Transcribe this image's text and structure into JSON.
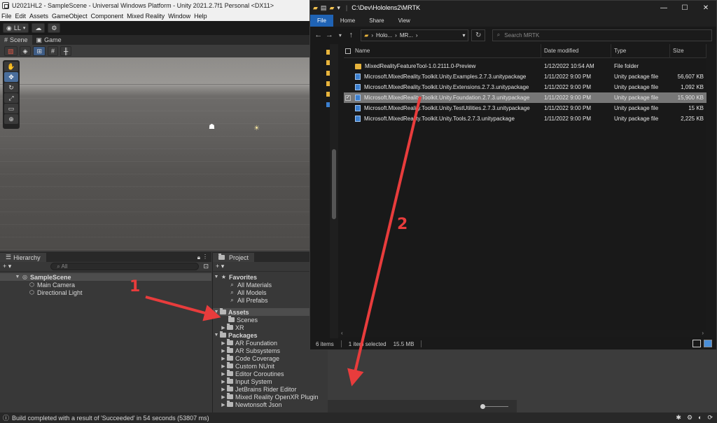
{
  "unity": {
    "window_title": "U2021HL2 - SampleScene - Universal Windows Platform - Unity 2021.2.7f1 Personal <DX11>",
    "menu": [
      "File",
      "Edit",
      "Assets",
      "GameObject",
      "Component",
      "Mixed Reality",
      "Window",
      "Help"
    ],
    "account_label": "LL",
    "tabs": [
      "Scene",
      "Game"
    ],
    "hierarchy": {
      "tab_label": "Hierarchy",
      "search_placeholder": "All",
      "scene_name": "SampleScene",
      "items": [
        "Main Camera",
        "Directional Light"
      ]
    },
    "project": {
      "tab_label": "Project",
      "favorites_label": "Favorites",
      "favorites": [
        "All Materials",
        "All Models",
        "All Prefabs"
      ],
      "assets_label": "Assets",
      "assets": [
        "Scenes",
        "XR"
      ],
      "packages_label": "Packages",
      "packages": [
        "AR Foundation",
        "AR Subsystems",
        "Code Coverage",
        "Custom NUnit",
        "Editor Coroutines",
        "Input System",
        "JetBrains Rider Editor",
        "Mixed Reality OpenXR Plugin",
        "Newtonsoft Json"
      ]
    },
    "status_message": "Build completed with a result of 'Succeeded' in 54 seconds (53807 ms)"
  },
  "explorer": {
    "title_path": "C:\\Dev\\Hololens2\\MRTK",
    "ribbon_tabs": [
      "File",
      "Home",
      "Share",
      "View"
    ],
    "breadcrumb": [
      "Holo...",
      "MR..."
    ],
    "search_placeholder": "Search MRTK",
    "columns": {
      "name": "Name",
      "date": "Date modified",
      "type": "Type",
      "size": "Size"
    },
    "rows": [
      {
        "name": "MixedRealityFeatureTool-1.0.2111.0-Preview",
        "date": "1/12/2022 10:54 AM",
        "type": "File folder",
        "size": "",
        "kind": "folder",
        "selected": false
      },
      {
        "name": "Microsoft.MixedReality.Toolkit.Unity.Examples.2.7.3.unitypackage",
        "date": "1/11/2022 9:00 PM",
        "type": "Unity package file",
        "size": "56,607 KB",
        "kind": "package",
        "selected": false
      },
      {
        "name": "Microsoft.MixedReality.Toolkit.Unity.Extensions.2.7.3.unitypackage",
        "date": "1/11/2022 9:00 PM",
        "type": "Unity package file",
        "size": "1,092 KB",
        "kind": "package",
        "selected": false
      },
      {
        "name": "Microsoft.MixedReality.Toolkit.Unity.Foundation.2.7.3.unitypackage",
        "date": "1/11/2022 9:00 PM",
        "type": "Unity package file",
        "size": "15,900 KB",
        "kind": "package",
        "selected": true
      },
      {
        "name": "Microsoft.MixedReality.Toolkit.Unity.TestUtilities.2.7.3.unitypackage",
        "date": "1/11/2022 9:00 PM",
        "type": "Unity package file",
        "size": "15 KB",
        "kind": "package",
        "selected": false
      },
      {
        "name": "Microsoft.MixedReality.Toolkit.Unity.Tools.2.7.3.unitypackage",
        "date": "1/11/2022 9:00 PM",
        "type": "Unity package file",
        "size": "2,225 KB",
        "kind": "package",
        "selected": false
      }
    ],
    "status": {
      "items": "6 items",
      "selected": "1 item selected",
      "size": "15.5 MB"
    }
  },
  "annotations": {
    "label_1": "1",
    "label_2": "2",
    "color": "#e83c3c"
  }
}
